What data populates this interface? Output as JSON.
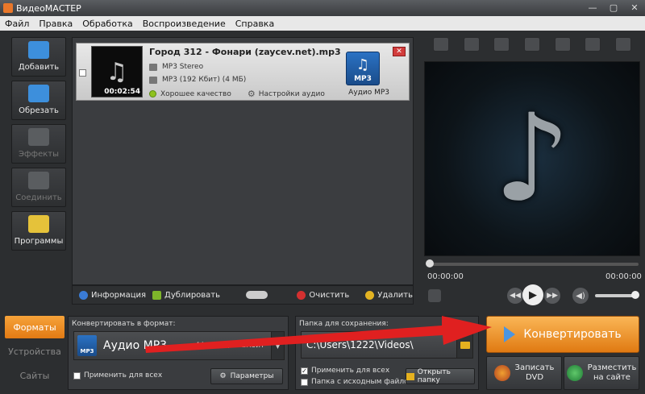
{
  "window": {
    "title": "ВидеоМАСТЕР",
    "buttons": [
      "—",
      "▢",
      "✕"
    ]
  },
  "menu": [
    "Файл",
    "Правка",
    "Обработка",
    "Воспроизведение",
    "Справка"
  ],
  "tools": [
    {
      "label": "Добавить",
      "icon": "add-film-icon",
      "color": "#3d8fdc",
      "enabled": true
    },
    {
      "label": "Обрезать",
      "icon": "cut-scissors-icon",
      "color": "#3d8fdc",
      "enabled": true
    },
    {
      "label": "Эффекты",
      "icon": "effects-icon",
      "color": "#5a5d60",
      "enabled": false
    },
    {
      "label": "Соединить",
      "icon": "join-icon",
      "color": "#5a5d60",
      "enabled": false
    },
    {
      "label": "Программы",
      "icon": "programs-icon",
      "color": "#e5c23a",
      "enabled": true
    }
  ],
  "file": {
    "title": "Город 312 - Фонари (zaycev.net).mp3",
    "duration": "00:02:54",
    "audio": "MP3 Stereo",
    "video": "MP3 (192 Кбит) (4 МБ)",
    "quality": "Хорошее качество",
    "audio_settings": "Настройки аудио",
    "format_badge": "MP3",
    "format_label": "Аудио MP3",
    "close": "✕"
  },
  "listbar": {
    "info": "Информация",
    "duplicate": "Дублировать",
    "clear": "Очистить",
    "delete": "Удалить"
  },
  "player": {
    "time_start": "00:00:00",
    "time_end": "00:00:00",
    "preview_icon": "♪"
  },
  "side_tabs": [
    "Форматы",
    "Устройства",
    "Сайты"
  ],
  "format": {
    "section": "Конвертировать в формат:",
    "name": "Аудио MP3",
    "badge": "MP3",
    "params": "44,1 KHz, 192Кбит",
    "apply_all": "Применить для всех",
    "settings_button": "Параметры"
  },
  "folder": {
    "section": "Папка для сохранения:",
    "path": "C:\\Users\\1222\\Videos\\",
    "apply_all": "Применить для всех",
    "source_folder": "Папка с исходным файлом",
    "open_button": "Открыть папку"
  },
  "actions": {
    "convert": "Конвертировать",
    "burn_dvd": "Записать\nDVD",
    "publish": "Разместить\nна сайте"
  },
  "colors": {
    "accent": "#f29a2e",
    "arrow": "#e02020"
  }
}
